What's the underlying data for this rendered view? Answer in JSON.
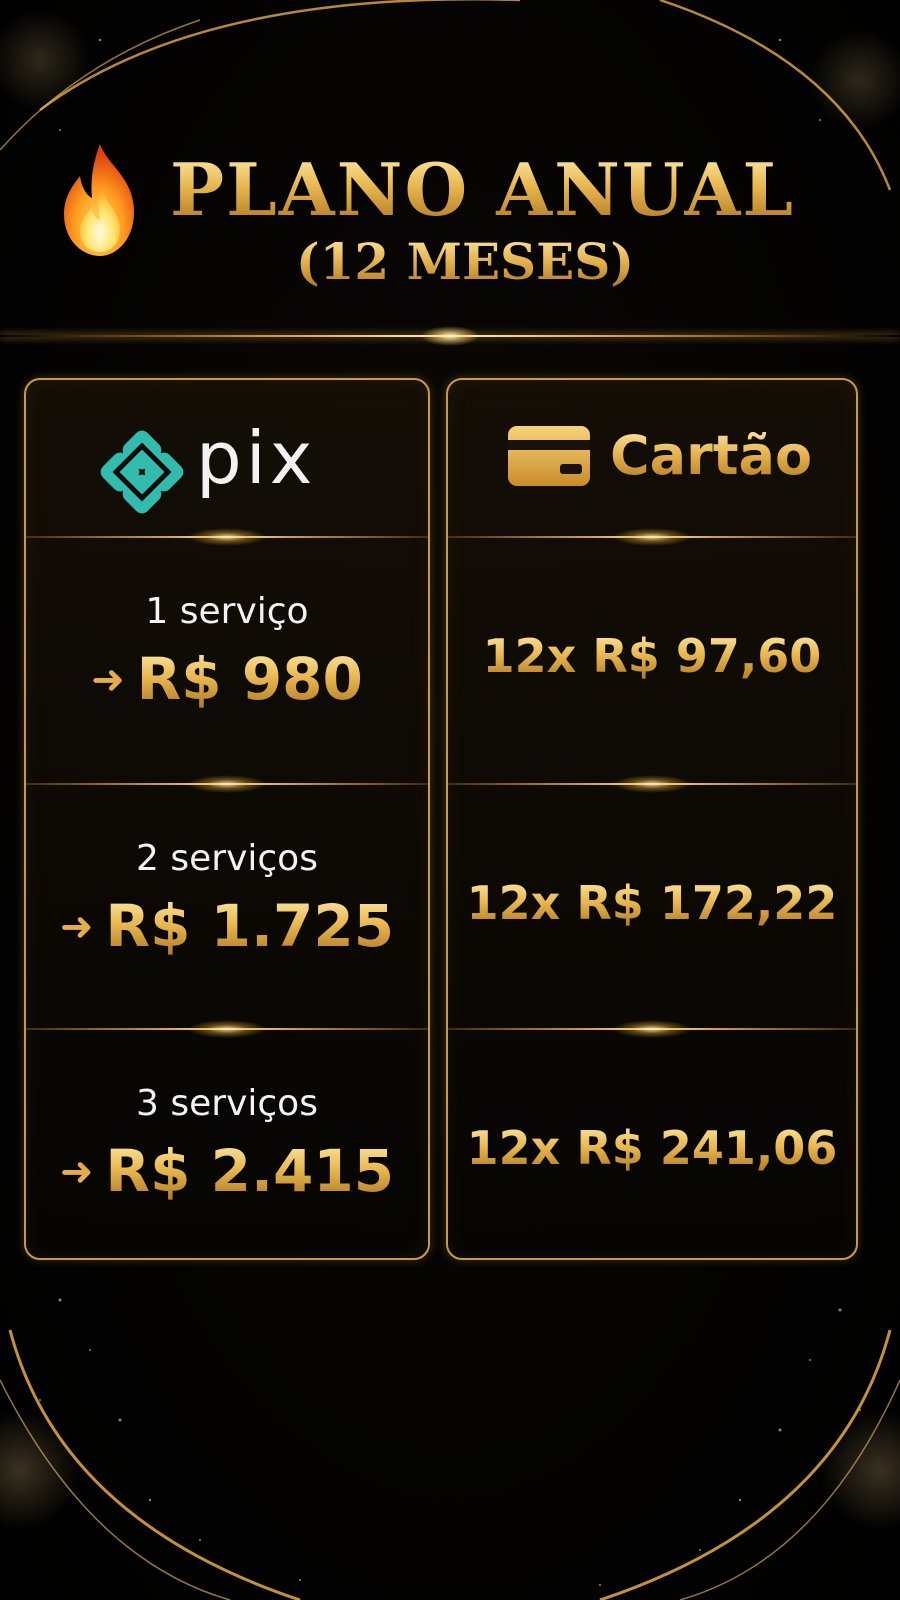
{
  "header": {
    "title": "PLANO ANUAL",
    "subtitle": "(12 MESES)",
    "title_icon": "fire-icon"
  },
  "columns": {
    "pix": {
      "label": "pix",
      "icon": "pix-logo-icon",
      "rows": [
        {
          "service": "1 serviço",
          "price": "R$ 980"
        },
        {
          "service": "2 serviços",
          "price": "R$ 1.725"
        },
        {
          "service": "3 serviços",
          "price": "R$ 2.415"
        }
      ]
    },
    "cartao": {
      "label": "Cartão",
      "icon": "credit-card-icon",
      "rows": [
        {
          "installment": "12x R$ 97,60"
        },
        {
          "installment": "12x R$ 172,22"
        },
        {
          "installment": "12x R$ 241,06"
        }
      ]
    }
  },
  "colors": {
    "gold": "#e4b04c",
    "pix_teal": "#32bcad",
    "background": "#000000"
  }
}
